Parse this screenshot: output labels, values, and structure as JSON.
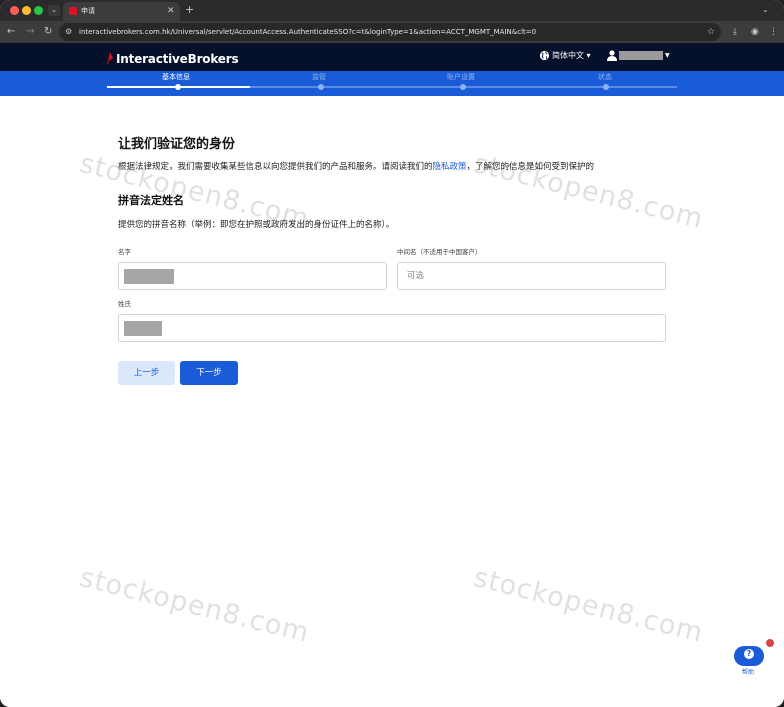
{
  "browser": {
    "tab_title": "申请",
    "url": "interactivebrokers.com.hk/Universal/servlet/AccountAccess.AuthenticateSSO?c=t&loginType=1&action=ACCT_MGMT_MAIN&clt=0"
  },
  "header": {
    "brand": "InteractiveBrokers",
    "brand_color": "#d81222",
    "language": "简体中文",
    "username": ""
  },
  "steps": [
    {
      "label": "基本信息",
      "active": true
    },
    {
      "label": "监管",
      "active": false
    },
    {
      "label": "账户设置",
      "active": false
    },
    {
      "label": "状态",
      "active": false
    }
  ],
  "main": {
    "title": "让我们验证您的身份",
    "intro_before": "根据法律规定，我们需要收集某些信息以向您提供我们的产品和服务。请阅读我们的",
    "intro_link": "隐私政策",
    "intro_after": "，了解您的信息是如何受到保护的",
    "section_title": "拼音法定姓名",
    "section_desc": "提供您的拼音名称（举例：即您在护照或政府发出的身份证件上的名称）。",
    "fields": {
      "first_name_label": "名字",
      "first_name_value": "",
      "middle_name_label": "中间名（不适用于中国客户）",
      "middle_name_placeholder": "可选",
      "last_name_label": "姓氏",
      "last_name_value": ""
    },
    "buttons": {
      "prev": "上一步",
      "next": "下一步"
    }
  },
  "watermark": "stockopen8.com",
  "help": {
    "label": "帮助",
    "icon": "help-question-icon"
  },
  "colors": {
    "header_bg": "#05102a",
    "steps_bg": "#1a5cd8",
    "primary": "#1a5cd8"
  }
}
